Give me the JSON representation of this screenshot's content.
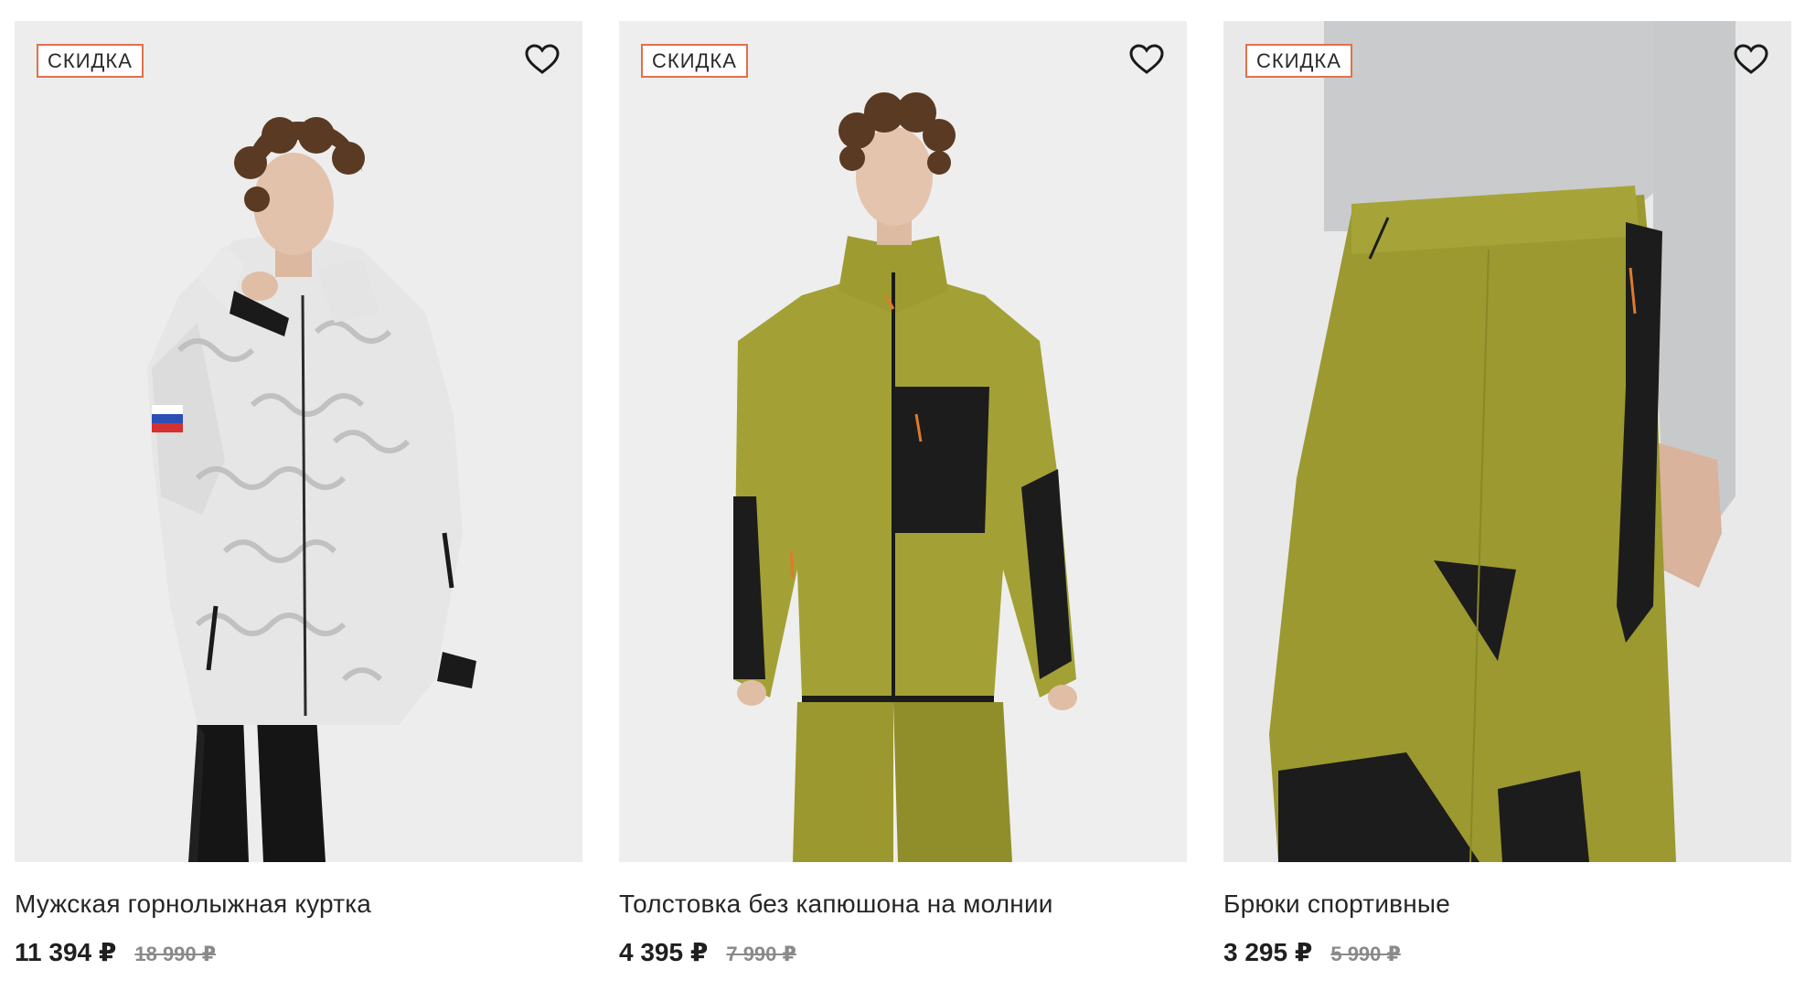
{
  "products": [
    {
      "badge": "СКИДКА",
      "title": "Мужская горнолыжная куртка",
      "price_current": "11 394 ₽",
      "price_old": "18 990 ₽",
      "image_alt": "man-in-white-ski-jacket",
      "favorite_icon": "heart-outline-icon"
    },
    {
      "badge": "СКИДКА",
      "title": "Толстовка без капюшона на молнии",
      "price_current": "4 395 ₽",
      "price_old": "7 990 ₽",
      "image_alt": "man-in-olive-fleece-zip-jacket",
      "favorite_icon": "heart-outline-icon"
    },
    {
      "badge": "СКИДКА",
      "title": "Брюки спортивные",
      "price_current": "3 295 ₽",
      "price_old": "5 990 ₽",
      "image_alt": "olive-sport-pants-closeup",
      "favorite_icon": "heart-outline-icon"
    }
  ],
  "colors": {
    "badge_border": "#e2704b",
    "olive": "#9c9a2f",
    "photo_bg": "#eeeeee"
  }
}
